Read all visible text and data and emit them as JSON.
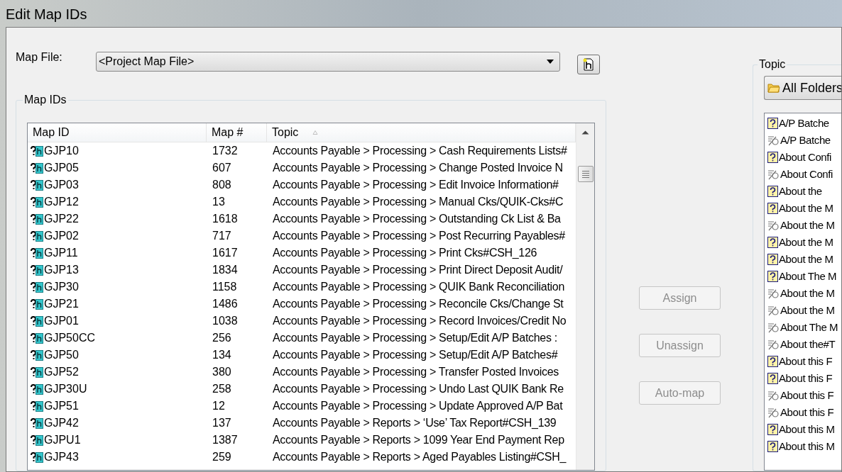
{
  "window": {
    "title": "Edit Map IDs"
  },
  "map_file": {
    "label": "Map File:",
    "value": "<Project Map File>"
  },
  "map_ids": {
    "title": "Map IDs",
    "columns": [
      {
        "label": "Map ID"
      },
      {
        "label": "Map #"
      },
      {
        "label": "Topic",
        "sorted": true
      }
    ],
    "rows": [
      {
        "id": "GJP10",
        "num": "1732",
        "topic": "Accounts Payable > Processing > Cash Requirements Lists#"
      },
      {
        "id": "GJP05",
        "num": "607",
        "topic": "Accounts Payable > Processing > Change Posted Invoice N"
      },
      {
        "id": "GJP03",
        "num": "808",
        "topic": "Accounts Payable > Processing > Edit Invoice Information#"
      },
      {
        "id": "GJP12",
        "num": "13",
        "topic": "Accounts Payable > Processing > Manual Cks/QUIK-Cks#C"
      },
      {
        "id": "GJP22",
        "num": "1618",
        "topic": "Accounts Payable > Processing > Outstanding Ck List & Ba"
      },
      {
        "id": "GJP02",
        "num": "717",
        "topic": "Accounts Payable > Processing > Post Recurring Payables#"
      },
      {
        "id": "GJP11",
        "num": "1617",
        "topic": "Accounts Payable > Processing > Print Cks#CSH_126"
      },
      {
        "id": "GJP13",
        "num": "1834",
        "topic": "Accounts Payable > Processing > Print Direct Deposit Audit/"
      },
      {
        "id": "GJP30",
        "num": "1158",
        "topic": "Accounts Payable > Processing > QUIK Bank Reconciliation"
      },
      {
        "id": "GJP21",
        "num": "1486",
        "topic": "Accounts Payable > Processing > Reconcile Cks/Change St"
      },
      {
        "id": "GJP01",
        "num": "1038",
        "topic": "Accounts Payable > Processing > Record Invoices/Credit No"
      },
      {
        "id": "GJP50CC",
        "num": "256",
        "topic": "Accounts Payable > Processing > Setup/Edit A/P Batches :"
      },
      {
        "id": "GJP50",
        "num": "134",
        "topic": "Accounts Payable > Processing > Setup/Edit A/P Batches#"
      },
      {
        "id": "GJP52",
        "num": "380",
        "topic": "Accounts Payable > Processing > Transfer Posted Invoices"
      },
      {
        "id": "GJP30U",
        "num": "258",
        "topic": "Accounts Payable > Processing > Undo Last QUIK Bank Re"
      },
      {
        "id": "GJP51",
        "num": "12",
        "topic": "Accounts Payable > Processing > Update Approved A/P Bat"
      },
      {
        "id": "GJP42",
        "num": "137",
        "topic": "Accounts Payable > Reports > ‘Use’ Tax Report#CSH_139"
      },
      {
        "id": "GJPU1",
        "num": "1387",
        "topic": "Accounts Payable > Reports > 1099 Year End Payment Rep"
      },
      {
        "id": "GJP43",
        "num": "259",
        "topic": "Accounts Payable > Reports > Aged Payables Listing#CSH_"
      }
    ]
  },
  "actions": [
    {
      "label": "Assign",
      "disabled": true
    },
    {
      "label": "Unassign",
      "disabled": true
    },
    {
      "label": "Auto-map",
      "disabled": true
    }
  ],
  "topic_panel": {
    "title": "Topic",
    "folder": "All Folders",
    "items": [
      {
        "kind": "topic",
        "label": "A/P Batche"
      },
      {
        "kind": "bookmark",
        "label": "A/P Batche"
      },
      {
        "kind": "topic",
        "label": "About Confi"
      },
      {
        "kind": "bookmark",
        "label": "About Confi"
      },
      {
        "kind": "topic",
        "label": "About the"
      },
      {
        "kind": "topic",
        "label": "About the M"
      },
      {
        "kind": "bookmark",
        "label": "About the M"
      },
      {
        "kind": "topic",
        "label": "About the M"
      },
      {
        "kind": "topic",
        "label": "About the M"
      },
      {
        "kind": "topic",
        "label": "About The M"
      },
      {
        "kind": "bookmark",
        "label": "About the M"
      },
      {
        "kind": "bookmark",
        "label": "About the M"
      },
      {
        "kind": "bookmark",
        "label": "About The M"
      },
      {
        "kind": "bookmark",
        "label": "About the#T"
      },
      {
        "kind": "topic",
        "label": "About this F"
      },
      {
        "kind": "topic",
        "label": "About this F"
      },
      {
        "kind": "bookmark",
        "label": "About this F"
      },
      {
        "kind": "bookmark",
        "label": "About this F"
      },
      {
        "kind": "topic",
        "label": "About this M"
      },
      {
        "kind": "topic",
        "label": "About this M"
      }
    ]
  }
}
